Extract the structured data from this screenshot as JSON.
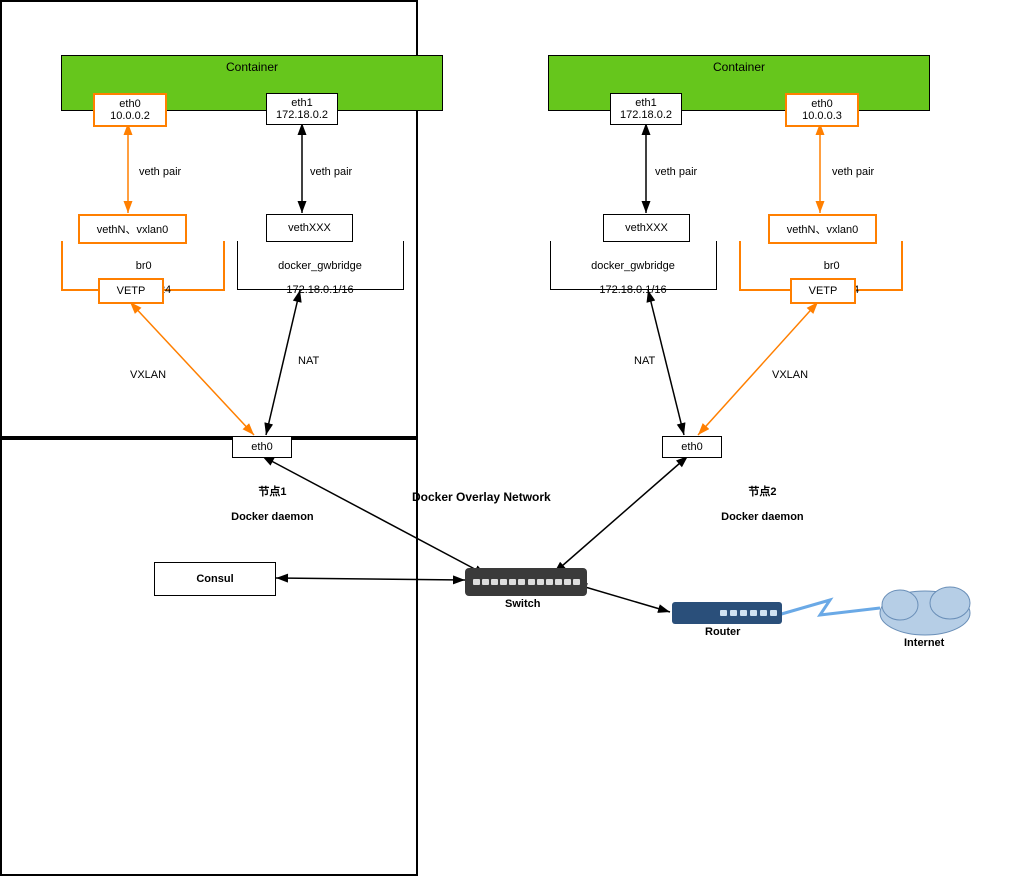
{
  "diagram": {
    "title": "Docker Overlay Network",
    "hosts": [
      {
        "node_label": "节点1",
        "daemon_label": "Docker daemon",
        "container_label": "Container",
        "eth0": {
          "name": "eth0",
          "ip": "10.0.0.2"
        },
        "eth1": {
          "name": "eth1",
          "ip": "172.18.0.2"
        },
        "veth_pair_left": "veth pair",
        "veth_pair_right": "veth pair",
        "vethN": "vethN、vxlan0",
        "br0": {
          "name": "br0",
          "ip": "10.0.0.1/24"
        },
        "vetp": "VETP",
        "vethXXX": "vethXXX",
        "gwbridge": {
          "name": "docker_gwbridge",
          "ip": "172.18.0.1/16"
        },
        "vxlan_label": "VXLAN",
        "nat_label": "NAT",
        "host_eth0": "eth0"
      },
      {
        "node_label": "节点2",
        "daemon_label": "Docker daemon",
        "container_label": "Container",
        "eth0": {
          "name": "eth0",
          "ip": "10.0.0.3"
        },
        "eth1": {
          "name": "eth1",
          "ip": "172.18.0.2"
        },
        "veth_pair_left": "veth pair",
        "veth_pair_right": "veth pair",
        "vethN": "vethN、vxlan0",
        "br0": {
          "name": "br0",
          "ip": "10.0.0.1/24"
        },
        "vetp": "VETP",
        "vethXXX": "vethXXX",
        "gwbridge": {
          "name": "docker_gwbridge",
          "ip": "172.18.0.1/16"
        },
        "vxlan_label": "VXLAN",
        "nat_label": "NAT",
        "host_eth0": "eth0"
      }
    ],
    "consul": "Consul",
    "switch": "Switch",
    "router": "Router",
    "internet": "Internet"
  },
  "colors": {
    "orange": "#ff7f00",
    "green": "#66c61c",
    "black": "#000000"
  }
}
